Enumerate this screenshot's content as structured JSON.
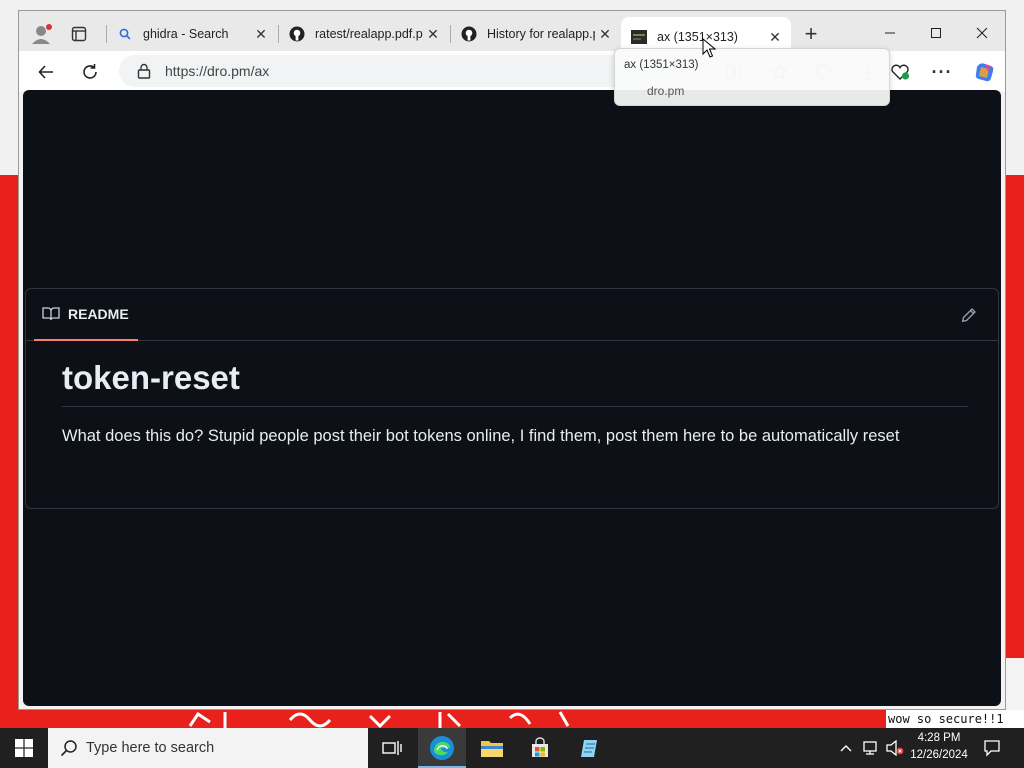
{
  "browser": {
    "tabs": [
      {
        "title": "ghidra - Search",
        "icon": "search-icon"
      },
      {
        "title": "ratest/realapp.pdf.py",
        "icon": "github-icon"
      },
      {
        "title": "History for realapp.py",
        "icon": "github-icon"
      },
      {
        "title": "ax (1351×313)",
        "icon": "image-thumbnail-icon",
        "active": true
      }
    ],
    "new_tab_label": "+",
    "address": {
      "url": "https://dro.pm/ax"
    },
    "hover_card": {
      "title": "ax (1351×313)",
      "domain": "dro.pm"
    }
  },
  "page": {
    "readme_tab_label": "README",
    "heading": "token-reset",
    "body": "What does this do? Stupid people post their bot tokens online, I find them, post them here to be automatically reset",
    "colors": {
      "background": "#0d1117",
      "border": "#30363d",
      "accent": "#f78166",
      "text": "#e6edf3"
    }
  },
  "desktop": {
    "caption": "wow so secure!!1"
  },
  "taskbar": {
    "search_placeholder": "Type here to search",
    "time": "4:28 PM",
    "date": "12/26/2024"
  }
}
